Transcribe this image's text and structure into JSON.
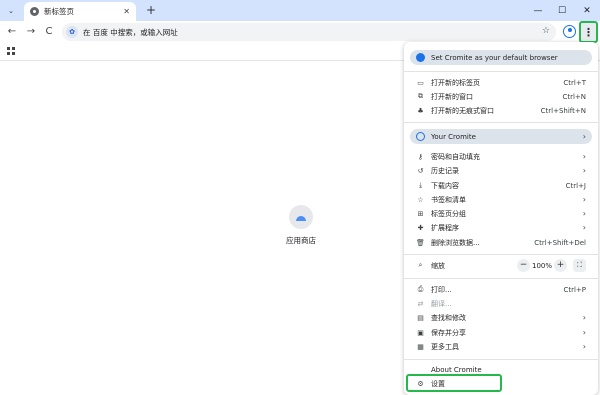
{
  "tab": {
    "title": "新标签页",
    "close": "✕"
  },
  "newtab_symbol": "+",
  "window": {
    "minimize": "—",
    "maximize": "☐",
    "close": "✕"
  },
  "toolbar": {
    "back": "←",
    "forward": "→",
    "reload": "C"
  },
  "omnibox": {
    "text": "在 百度 中搜索，或输入网址",
    "engine_glyph": "✿",
    "star": "☆"
  },
  "menu_glyph": "⋮",
  "shortcut": {
    "label": "应用商店"
  },
  "menu": {
    "default_browser": "Set Cromite as your default browser",
    "new_tab": {
      "label": "打开新的标签页",
      "shortcut": "Ctrl+T"
    },
    "new_window": {
      "label": "打开新的窗口",
      "shortcut": "Ctrl+N"
    },
    "incognito": {
      "label": "打开新的无痕式窗口",
      "shortcut": "Ctrl+Shift+N"
    },
    "your_cromite": "Your Cromite",
    "passwords": {
      "label": "密码和自动填充"
    },
    "history": {
      "label": "历史记录"
    },
    "downloads": {
      "label": "下载内容",
      "shortcut": "Ctrl+J"
    },
    "bookmarks": {
      "label": "书签和清单"
    },
    "tab_groups": {
      "label": "标签页分组"
    },
    "extensions": {
      "label": "扩展程序"
    },
    "clear_data": {
      "label": "删除浏览数据...",
      "shortcut": "Ctrl+Shift+Del"
    },
    "zoom": {
      "label": "缩放",
      "minus": "−",
      "value": "100%",
      "plus": "+"
    },
    "print": {
      "label": "打印...",
      "shortcut": "Ctrl+P"
    },
    "translate": {
      "label": "翻译..."
    },
    "find_edit": {
      "label": "查找和修改"
    },
    "save_share": {
      "label": "保存并分享"
    },
    "more_tools": {
      "label": "更多工具"
    },
    "about": {
      "label": "About Cromite"
    },
    "settings": {
      "label": "设置"
    },
    "chevron": "›"
  },
  "colors": {
    "tabstrip": "#d3e3fd",
    "accent_blue": "#1a73e8",
    "highlight_green": "#26b84b",
    "pill": "#dde3ea"
  }
}
